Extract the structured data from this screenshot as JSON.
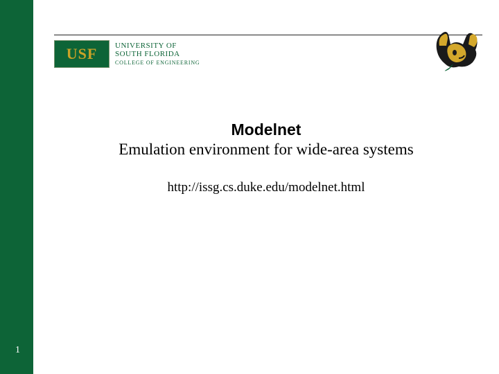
{
  "page_number": "1",
  "logo": {
    "badge_text": "USF",
    "line1": "UNIVERSITY OF",
    "line2": "SOUTH FLORIDA",
    "line3": "COLLEGE OF ENGINEERING"
  },
  "title": {
    "main": "Modelnet",
    "subtitle": "Emulation environment for wide-area systems"
  },
  "url": "http://issg.cs.duke.edu/modelnet.html"
}
